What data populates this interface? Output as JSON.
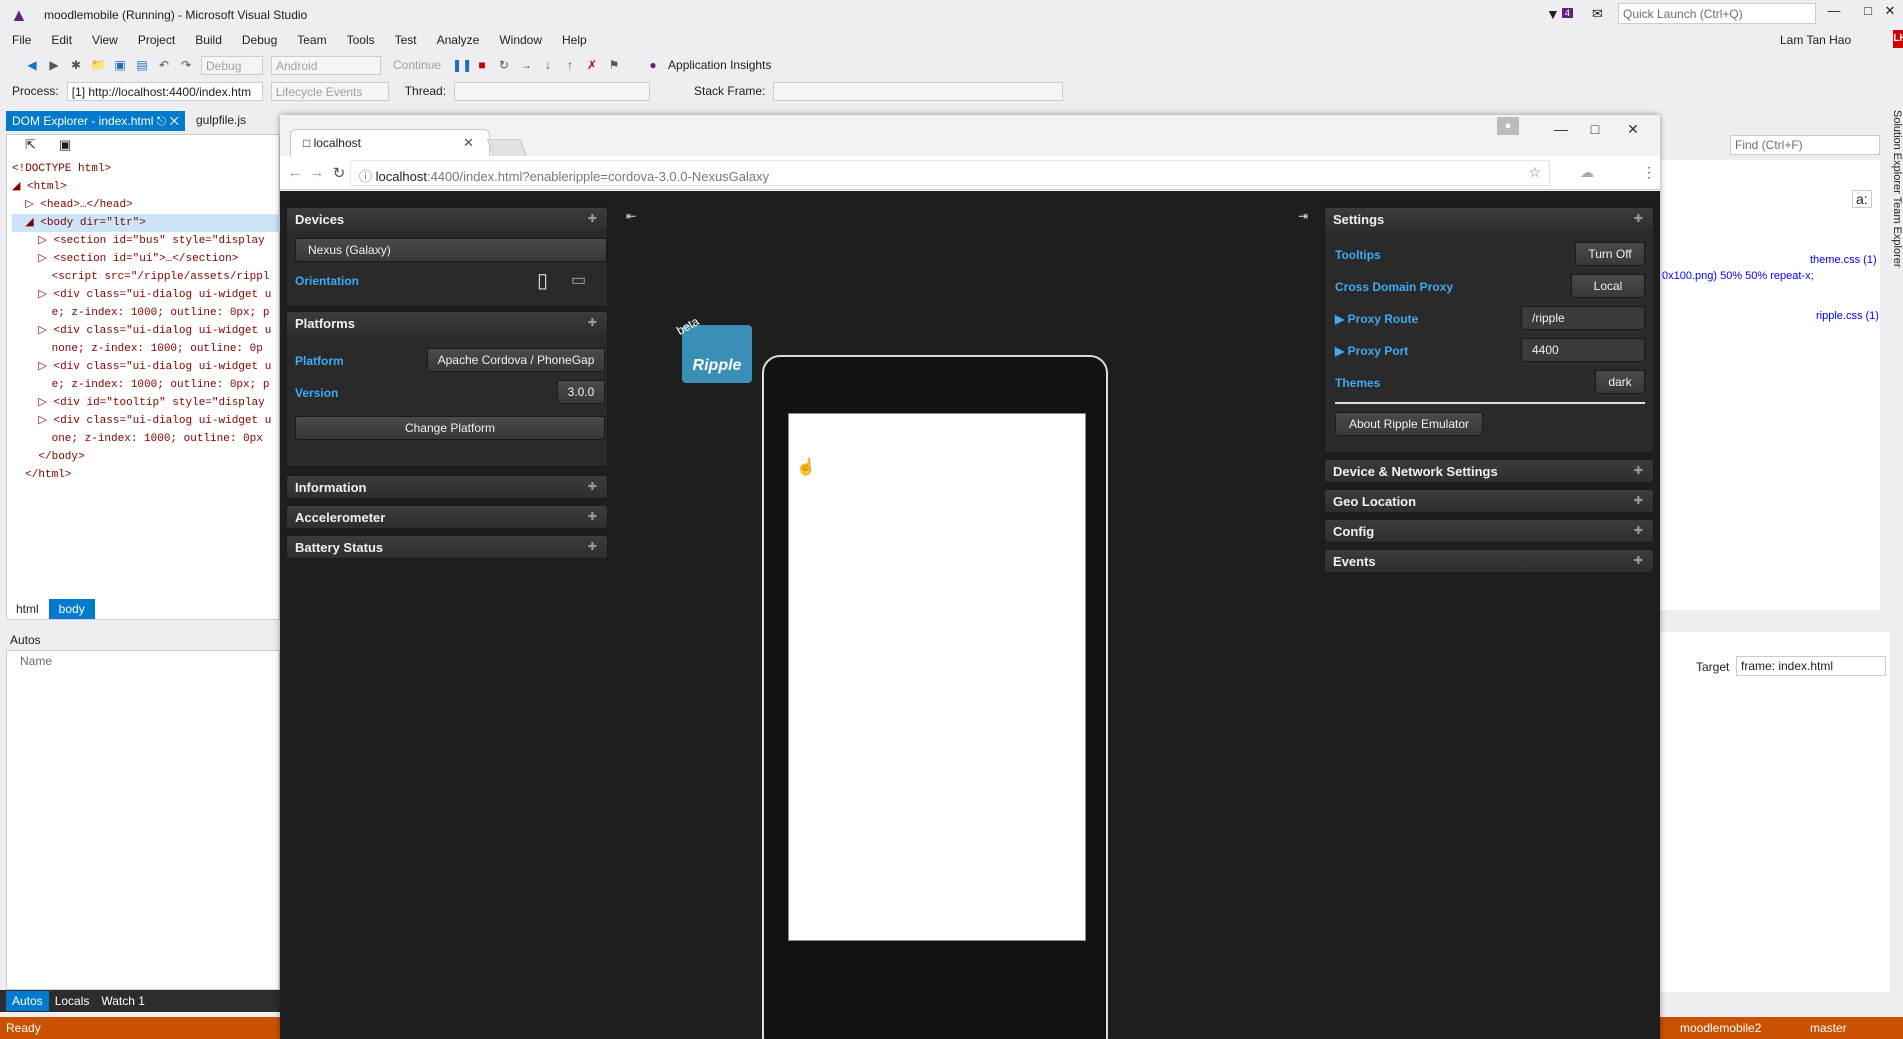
{
  "vs": {
    "window_title": "moodlemobile (Running) - Microsoft Visual Studio",
    "notification_count": "4",
    "quick_launch_placeholder": "Quick Launch (Ctrl+Q)",
    "menu": [
      "File",
      "Edit",
      "View",
      "Project",
      "Build",
      "Debug",
      "Team",
      "Tools",
      "Test",
      "Analyze",
      "Window",
      "Help"
    ],
    "user_name": "Lam Tan Hao",
    "user_initials": "LH",
    "toolbar": {
      "config": "Debug",
      "platform": "Android",
      "continue": "Continue",
      "app_insights": "Application Insights"
    },
    "toolbar2": {
      "process_label": "Process:",
      "process_value": "[1] http://localhost:4400/index.htm",
      "lifecycle": "Lifecycle Events",
      "thread_label": "Thread:",
      "stack_frame_label": "Stack Frame:"
    },
    "dom_explorer": {
      "tab": "DOM Explorer - index.html",
      "other_tab": "gulpfile.js",
      "breadcrumbs": [
        "html",
        "body"
      ],
      "tree": [
        "<!DOCTYPE html>",
        "◢ <html>",
        "  ▷ <head>…</head>",
        "  ◢ <body dir=\"ltr\">",
        "    ▷ <section id=\"bus\" style=\"display",
        "    ▷ <section id=\"ui\">…</section>",
        "      <script src=\"/ripple/assets/rippl",
        "    ▷ <div class=\"ui-dialog ui-widget u",
        "      e; z-index: 1000; outline: 0px; p",
        "    ▷ <div class=\"ui-dialog ui-widget u",
        "      none; z-index: 1000; outline: 0p",
        "    ▷ <div class=\"ui-dialog ui-widget u",
        "      e; z-index: 1000; outline: 0px; p",
        "    ▷ <div id=\"tooltip\" style=\"display",
        "    ▷ <div class=\"ui-dialog ui-widget u",
        "      one; z-index: 1000; outline: 0px",
        "    </body>",
        "  </html>"
      ]
    },
    "autos": {
      "title": "Autos",
      "col_name": "Name",
      "tabs": [
        "Autos",
        "Locals",
        "Watch 1"
      ]
    },
    "right": {
      "find_placeholder": "Find (Ctrl+F)",
      "css_link1": "theme.css (1)",
      "css_snippet": "0x100.png) 50% 50% repeat-x;",
      "css_link2": "ripple.css (1)",
      "target_label": "Target",
      "target_value": "frame: index.html",
      "side_tabs": "Solution Explorer  Team Explorer"
    },
    "status": {
      "ready": "Ready",
      "repo": "moodlemobile2",
      "branch": "master"
    }
  },
  "browser": {
    "tab_title": "localhost",
    "url_host": "localhost",
    "url_rest": ":4400/index.html?enableripple=cordova-3.0.0-NexusGalaxy"
  },
  "ripple": {
    "left": {
      "devices": {
        "title": "Devices",
        "device": "Nexus (Galaxy)",
        "orientation_label": "Orientation"
      },
      "platforms": {
        "title": "Platforms",
        "platform_label": "Platform",
        "platform_value": "Apache Cordova / PhoneGap",
        "version_label": "Version",
        "version_value": "3.0.0",
        "change_button": "Change Platform"
      },
      "collapsed": [
        "Information",
        "Accelerometer",
        "Battery Status"
      ]
    },
    "right": {
      "settings": {
        "title": "Settings",
        "tooltips_label": "Tooltips",
        "tooltips_value": "Turn Off",
        "proxy_label": "Cross Domain Proxy",
        "proxy_value": "Local",
        "route_label": "▶ Proxy Route",
        "route_value": "/ripple",
        "port_label": "▶ Proxy Port",
        "port_value": "4400",
        "themes_label": "Themes",
        "themes_value": "dark",
        "about_button": "About Ripple Emulator"
      },
      "collapsed": [
        "Device & Network Settings",
        "Geo Location",
        "Config",
        "Events"
      ]
    },
    "logo_text": "Ripple",
    "beta": "beta"
  }
}
